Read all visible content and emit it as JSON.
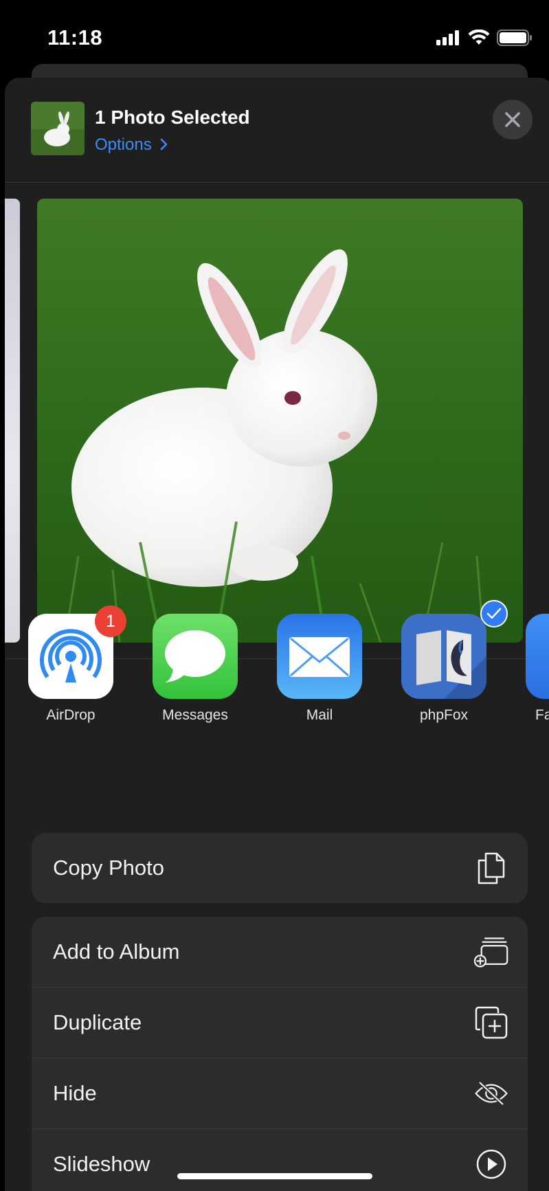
{
  "status_bar": {
    "time": "11:18"
  },
  "header": {
    "title": "1 Photo Selected",
    "options_label": "Options"
  },
  "apps": [
    {
      "label": "AirDrop",
      "badge": "1"
    },
    {
      "label": "Messages"
    },
    {
      "label": "Mail"
    },
    {
      "label": "phpFox"
    },
    {
      "label": "Fa"
    }
  ],
  "actions_group1": [
    {
      "label": "Copy Photo",
      "icon": "copy-icon"
    }
  ],
  "actions_group2": [
    {
      "label": "Add to Album",
      "icon": "add-to-album-icon"
    },
    {
      "label": "Duplicate",
      "icon": "duplicate-icon"
    },
    {
      "label": "Hide",
      "icon": "eye-slash-icon"
    },
    {
      "label": "Slideshow",
      "icon": "play-circle-icon"
    }
  ],
  "colors": {
    "accent": "#3a8ef7",
    "sheet": "#1f1f20",
    "row": "#2c2c2e",
    "badge": "#eb4034"
  }
}
